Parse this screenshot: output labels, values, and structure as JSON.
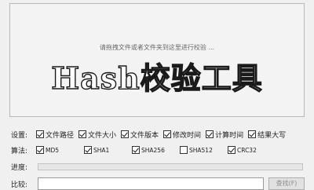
{
  "drop_area": {
    "hint": "请拖拽文件或者文件夹到这里进行校验 ...",
    "title": "Hash校验工具"
  },
  "settings": {
    "label": "设置:",
    "options": [
      {
        "label": "文件路径",
        "checked": true
      },
      {
        "label": "文件大小",
        "checked": true
      },
      {
        "label": "文件版本",
        "checked": true
      },
      {
        "label": "修改时间",
        "checked": true
      },
      {
        "label": "计算时间",
        "checked": true
      },
      {
        "label": "结果大写",
        "checked": true
      }
    ]
  },
  "algorithms": {
    "label": "算法:",
    "options": [
      {
        "label": "MD5",
        "checked": true
      },
      {
        "label": "SHA1",
        "checked": true
      },
      {
        "label": "SHA256",
        "checked": true
      },
      {
        "label": "SHA512",
        "checked": false
      },
      {
        "label": "CRC32",
        "checked": true
      }
    ]
  },
  "progress": {
    "label": "进度:",
    "value_percent": 0
  },
  "compare": {
    "label": "比较:",
    "value": "",
    "button_label": "查找(F)"
  }
}
